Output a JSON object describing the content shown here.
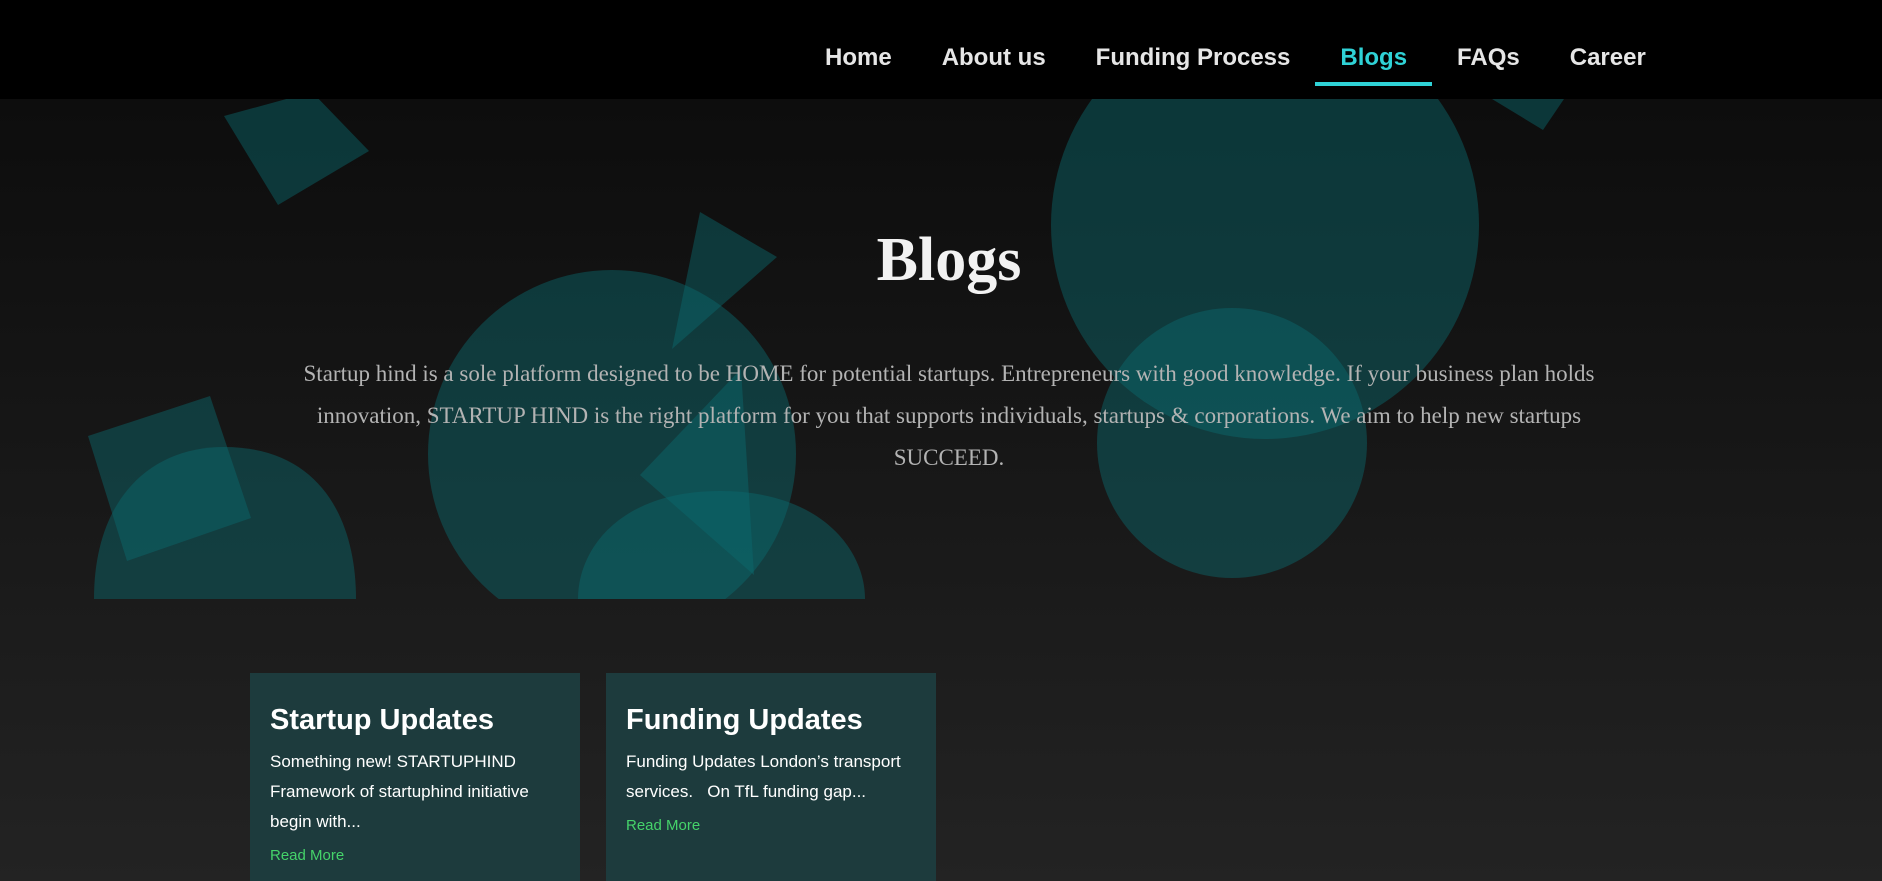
{
  "nav": {
    "items": [
      {
        "label": "Home",
        "active": false
      },
      {
        "label": "About us",
        "active": false
      },
      {
        "label": "Funding Process",
        "active": false
      },
      {
        "label": "Blogs",
        "active": true
      },
      {
        "label": "FAQs",
        "active": false
      },
      {
        "label": "Career",
        "active": false
      }
    ]
  },
  "hero": {
    "title": "Blogs",
    "description": "Startup hind is a sole platform designed to be HOME for potential startups. Entrepreneurs with good knowledge. If your business plan holds innovation, STARTUP HIND is the right platform for you that supports individuals, startups & corporations. We aim to help new startups SUCCEED."
  },
  "cards": [
    {
      "title": "Startup Updates",
      "text": "Something new! STARTUPHIND Framework of startuphind initiative begin with...",
      "link": "Read More"
    },
    {
      "title": "Funding Updates",
      "text": "Funding Updates London’s transport services.   On TfL funding gap...",
      "link": "Read More"
    }
  ],
  "colors": {
    "accent": "#2fd2d6",
    "header_bg": "#000000",
    "card_bg": "#1d3b3d",
    "link": "#45d36a",
    "shape": "#0b6a6f"
  }
}
